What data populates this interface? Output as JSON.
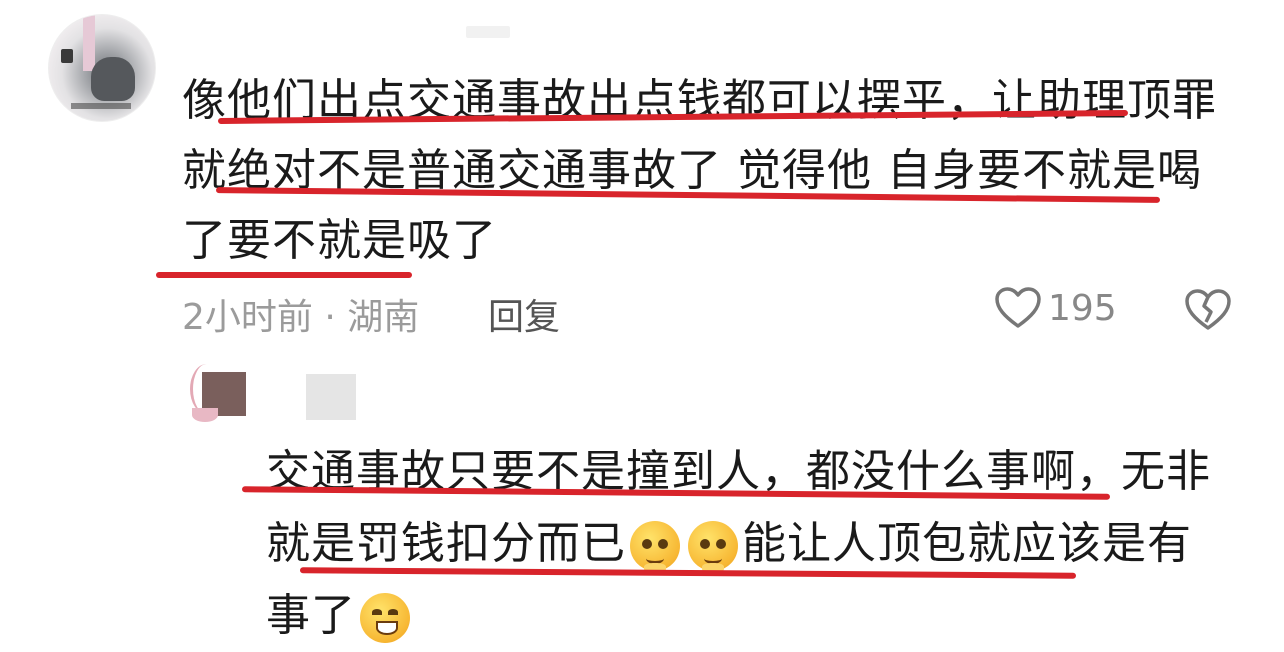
{
  "comment": {
    "lines": [
      "像他们出点交通事故出点钱都可以摆平，让助理顶罪",
      "就绝对不是普通交通事故了 觉得他 自身要不就是喝",
      "了要不就是吸了"
    ],
    "time_location": "2小时前 · 湖南",
    "reply_label": "回复",
    "like_count": "195"
  },
  "reply": {
    "line1": "交通事故只要不是撞到人，都没什么事啊，无非",
    "line2_a": "就是罚钱扣分而已",
    "line2_b": "能让人顶包就应该是有",
    "line3": "事了"
  },
  "icons": {
    "like": "heart-outline-icon",
    "dislike": "broken-heart-icon",
    "emoji_pleading": "pleading-face-icon",
    "emoji_grin": "grinning-face-icon"
  },
  "colors": {
    "underline": "#d8242b",
    "meta_text": "#9b9b9b",
    "body_text": "#1a1a1a"
  }
}
